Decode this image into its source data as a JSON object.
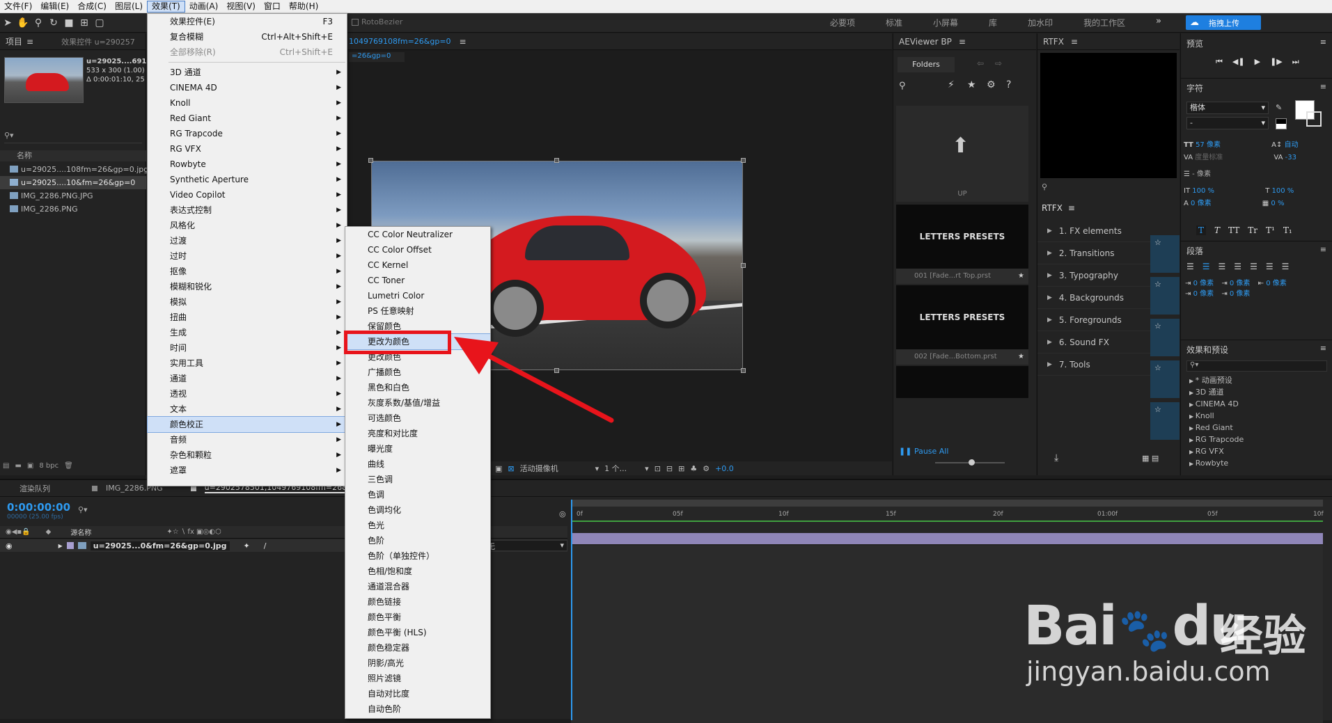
{
  "menubar": {
    "items": [
      "文件(F)",
      "编辑(E)",
      "合成(C)",
      "图层(L)",
      "效果(T)",
      "动画(A)",
      "视图(V)",
      "窗口",
      "帮助(H)"
    ]
  },
  "toolbar": {
    "rotobezier": "RotoBezier",
    "workspaces": [
      "必要项",
      "标准",
      "小屏幕",
      "库",
      "加水印",
      "我的工作区"
    ],
    "upload_label": "拖拽上传"
  },
  "project_panel": {
    "tab_project": "项目",
    "tab_effects": "效果控件 u=290257",
    "thumb_name": "u=29025....6910",
    "thumb_size": "533 x 300 (1.00)",
    "thumb_dur": "Δ 0:00:01:10, 25",
    "search_placeholder": "",
    "col_name": "名称",
    "items": [
      "u=29025....108fm=26&gp=0.jpg",
      "u=29025....10&fm=26&gp=0",
      "IMG_2286.PNG.JPG",
      "IMG_2286.PNG"
    ],
    "bpc": "8 bpc"
  },
  "effects_menu": {
    "items": [
      {
        "label": "效果控件(E)",
        "shortcut": "F3"
      },
      {
        "label": "复合模糊",
        "shortcut": "Ctrl+Alt+Shift+E"
      },
      {
        "label": "全部移除(R)",
        "shortcut": "Ctrl+Shift+E",
        "disabled": true
      },
      {
        "label": "3D 通道"
      },
      {
        "label": "CINEMA 4D"
      },
      {
        "label": "Knoll"
      },
      {
        "label": "Red Giant"
      },
      {
        "label": "RG Trapcode"
      },
      {
        "label": "RG VFX"
      },
      {
        "label": "Rowbyte"
      },
      {
        "label": "Synthetic Aperture"
      },
      {
        "label": "Video Copilot"
      },
      {
        "label": "表达式控制"
      },
      {
        "label": "风格化"
      },
      {
        "label": "过渡"
      },
      {
        "label": "过时"
      },
      {
        "label": "抠像"
      },
      {
        "label": "模糊和锐化"
      },
      {
        "label": "模拟"
      },
      {
        "label": "扭曲"
      },
      {
        "label": "生成"
      },
      {
        "label": "时间"
      },
      {
        "label": "实用工具"
      },
      {
        "label": "通道"
      },
      {
        "label": "透视"
      },
      {
        "label": "文本"
      },
      {
        "label": "颜色校正",
        "active": true
      },
      {
        "label": "音频"
      },
      {
        "label": "杂色和颗粒"
      },
      {
        "label": "遮罩"
      }
    ]
  },
  "color_submenu": {
    "items": [
      "CC Color Neutralizer",
      "CC Color Offset",
      "CC Kernel",
      "CC Toner",
      "Lumetri Color",
      "PS 任意映射",
      "保留颜色",
      "更改为颜色",
      "更改颜色",
      "广播颜色",
      "黑色和白色",
      "灰度系数/基值/增益",
      "可选颜色",
      "亮度和对比度",
      "曝光度",
      "曲线",
      "三色调",
      "色调",
      "色调均化",
      "色光",
      "色阶",
      "色阶（单独控件）",
      "色相/饱和度",
      "通道混合器",
      "颜色链接",
      "颜色平衡",
      "颜色平衡 (HLS)",
      "颜色稳定器",
      "阴影/高光",
      "照片滤镜",
      "自动对比度",
      "自动色阶"
    ],
    "highlighted": "更改为颜色"
  },
  "comp_panel": {
    "tab_label": "1049769108fm=26&gp=0",
    "sub_tab": "=26&gp=0",
    "camera": "活动摄像机",
    "views": "1 个...",
    "offset": "+0.0"
  },
  "aeviewer": {
    "title": "AEViewer BP",
    "folders": "Folders",
    "up": "UP",
    "presets": [
      {
        "thumb_text": "LETTERS PRESETS",
        "name": "001 [Fade...rt Top.prst"
      },
      {
        "thumb_text": "LETTERS PRESETS",
        "name": "002 [Fade...Bottom.prst"
      }
    ],
    "pause_all": "Pause All"
  },
  "rtfx": {
    "title": "RTFX",
    "menu_label": "RTFX",
    "items": [
      "1. FX elements",
      "2. Transitions",
      "3. Typography",
      "4. Backgrounds",
      "5. Foregrounds",
      "6. Sound FX",
      "7. Tools"
    ]
  },
  "preview": {
    "title": "预览"
  },
  "character": {
    "title": "字符",
    "font": "楷体",
    "style": "-",
    "size": "57 像素",
    "leading": "自动",
    "kerning": "度量标准",
    "tracking": "-33",
    "stroke": "- 像素",
    "vscale": "100 %",
    "hscale": "100 %",
    "baseline": "0 像素",
    "tsume": "0 %",
    "style_buttons": [
      "T",
      "T",
      "TT",
      "Tr",
      "T¹",
      "T₁"
    ]
  },
  "paragraph": {
    "title": "段落",
    "indents": [
      "0 像素",
      "0 像素",
      "0 像素",
      "0 像素",
      "0 像素"
    ]
  },
  "effects_presets": {
    "title": "效果和预设",
    "items": [
      "* 动画预设",
      "3D 通道",
      "CINEMA 4D",
      "Knoll",
      "Red Giant",
      "RG Trapcode",
      "RG VFX",
      "Rowbyte"
    ]
  },
  "timeline": {
    "tab_render": "渲染队列",
    "tab_img": "IMG_2286.PNG",
    "tab_comp": "u=2902578501,1049769108fm=26&gp",
    "timecode": "0:00:00:00",
    "timecode_sub": "00000 (25.00 fps)",
    "col_source": "源名称",
    "layer_name": "u=29025...0&fm=26&gp=0.jpg",
    "parent_value": "无",
    "ruler": [
      "0f",
      "05f",
      "10f",
      "15f",
      "20f",
      "01:00f",
      "05f",
      "10f"
    ]
  },
  "watermark": {
    "brand": "Bai",
    "brand2": "du",
    "cn": "经验",
    "url": "jingyan.baidu.com"
  },
  "colors": {
    "accent_blue": "#2e9af0",
    "highlight_red": "#e8141b",
    "car_red": "#d41a1f"
  }
}
